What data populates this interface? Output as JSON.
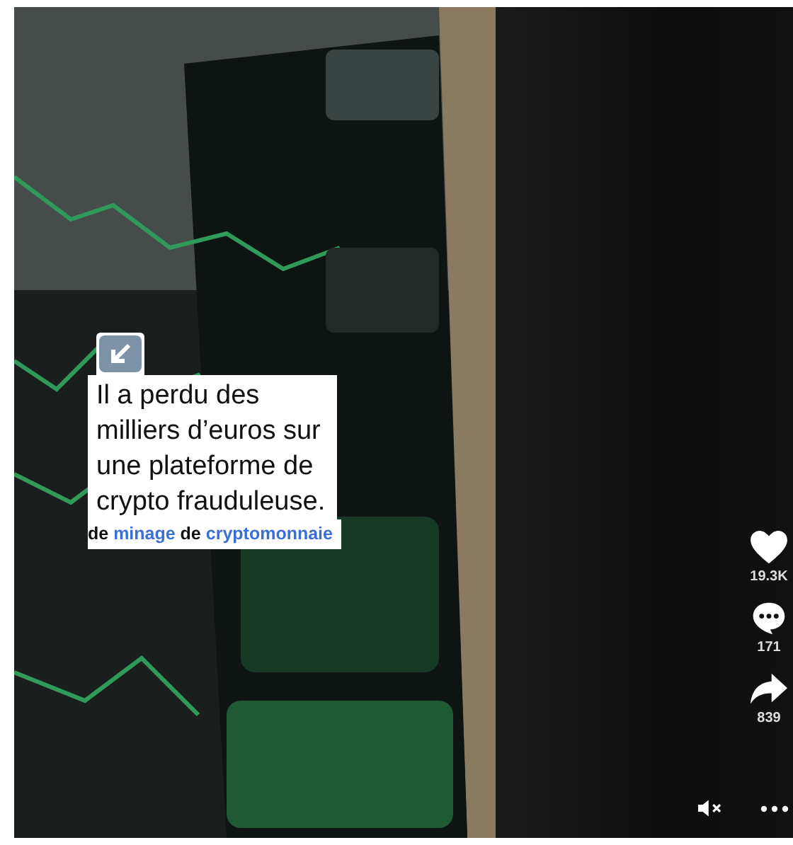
{
  "caption": {
    "text": "Il a perdu des\nmilliers d’euros sur\nune plateforme de\ncrypto frauduleuse."
  },
  "description": [
    {
      "text": "de ",
      "link": false
    },
    {
      "text": "minage",
      "link": true
    },
    {
      "text": " de ",
      "link": false
    },
    {
      "text": "cryptomonnaie",
      "link": true
    }
  ],
  "actions": [
    {
      "kind": "like",
      "count": "19.3K"
    },
    {
      "kind": "comment",
      "count": "171"
    },
    {
      "kind": "share",
      "count": "839"
    }
  ],
  "sound": {
    "muted": true
  }
}
